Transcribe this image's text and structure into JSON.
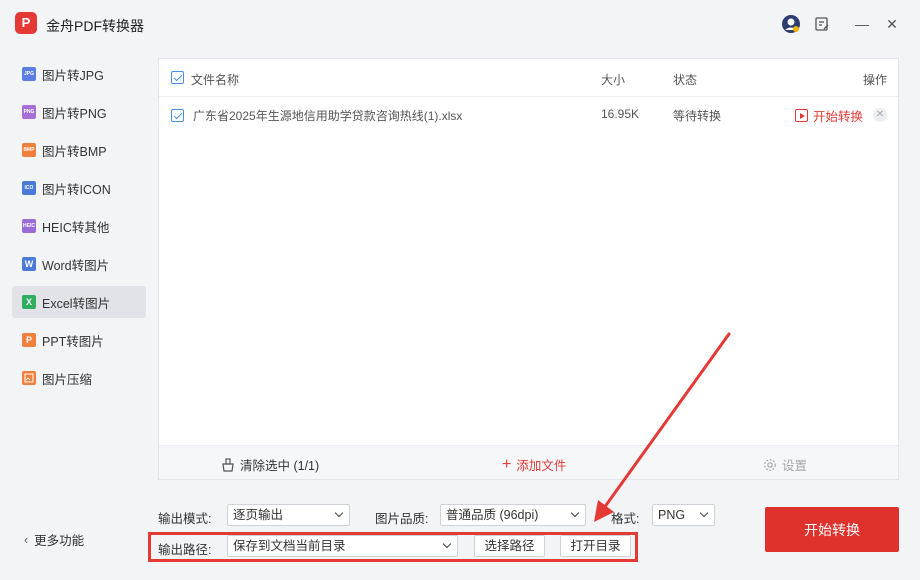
{
  "app": {
    "title": "金舟PDF转换器",
    "logo_glyph": "P",
    "window_controls": [
      "avatar-icon",
      "feedback-icon",
      "minimize-icon",
      "close-icon"
    ],
    "minimize_glyph": "—",
    "close_glyph": "✕"
  },
  "sidebar": {
    "items": [
      {
        "label": "图片转JPG",
        "icon": "jpg-icon",
        "icon_text": "JPG",
        "icon_color": "#5b7ee5",
        "active": false
      },
      {
        "label": "图片转PNG",
        "icon": "png-icon",
        "icon_text": "PNG",
        "icon_color": "#a670d8",
        "active": false
      },
      {
        "label": "图片转BMP",
        "icon": "bmp-icon",
        "icon_text": "BMP",
        "icon_color": "#ef7f3a",
        "active": false
      },
      {
        "label": "图片转ICON",
        "icon": "icon-format-icon",
        "icon_text": "ICO",
        "icon_color": "#4b7bd9",
        "active": false
      },
      {
        "label": "HEIC转其他",
        "icon": "heic-icon",
        "icon_text": "HEIC",
        "icon_color": "#9b6bd8",
        "active": false
      },
      {
        "label": "Word转图片",
        "icon": "word-icon",
        "icon_text": "W",
        "icon_color": "#4b7bd9",
        "active": false
      },
      {
        "label": "Excel转图片",
        "icon": "excel-icon",
        "icon_text": "X",
        "icon_color": "#2fae5f",
        "active": true
      },
      {
        "label": "PPT转图片",
        "icon": "ppt-icon",
        "icon_text": "P",
        "icon_color": "#ef7f3a",
        "active": false
      },
      {
        "label": "图片压缩",
        "icon": "compress-icon",
        "icon_text": "",
        "icon_color": "#ef7f3a",
        "active": false
      }
    ],
    "more": "更多功能"
  },
  "file_table": {
    "headers": {
      "name": "文件名称",
      "size": "大小",
      "status": "状态",
      "action": "操作"
    },
    "rows": [
      {
        "name": "广东省2025年生源地信用助学贷款咨询热线(1).xlsx",
        "size": "16.95K",
        "status": "等待转换",
        "action": "开始转换",
        "checked": true
      }
    ]
  },
  "panel_footer": {
    "clear": "清除选中 (1/1)",
    "add": "添加文件",
    "settings": "设置"
  },
  "options": {
    "mode_label": "输出模式:",
    "mode_value": "逐页输出",
    "quality_label": "图片品质:",
    "quality_value": "普通品质 (96dpi)",
    "format_label": "格式:",
    "format_value": "PNG",
    "path_label": "输出路径:",
    "path_value": "保存到文档当前目录",
    "choose_path": "选择路径",
    "open_dir": "打开目录"
  },
  "start_button": "开始转换",
  "colors": {
    "accent_red": "#e0322c",
    "checkbox_blue": "#4a90e2",
    "add_red": "#e53935"
  }
}
